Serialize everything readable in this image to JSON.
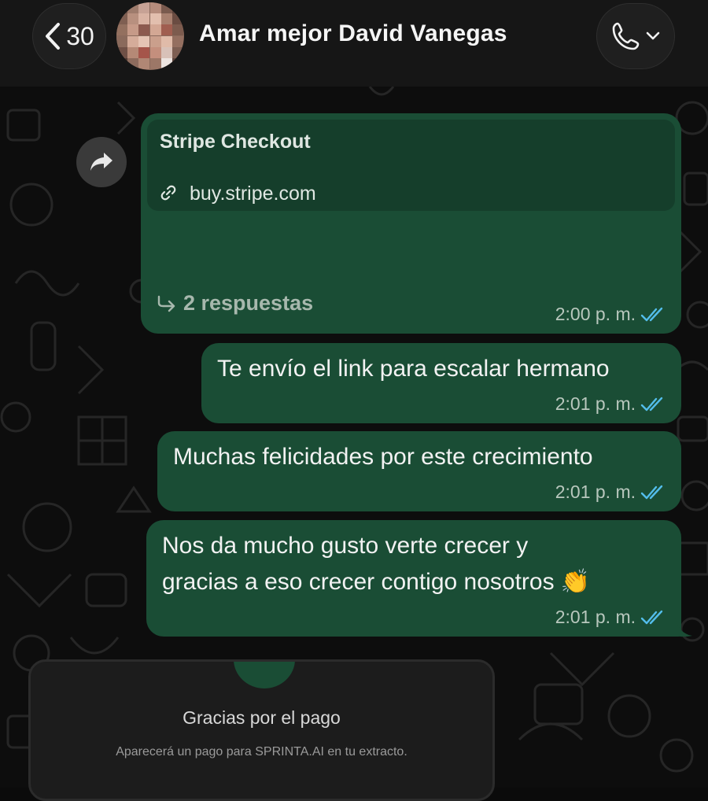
{
  "header": {
    "back_count": "30",
    "contact_name": "Amar mejor David Vanegas"
  },
  "messages": [
    {
      "type": "link-preview",
      "preview_title": "Stripe Checkout",
      "preview_link": "buy.stripe.com",
      "replies": "2 respuestas",
      "time": "2:00 p. m."
    },
    {
      "type": "text",
      "lines": [
        "Te envío el link para escalar hermano"
      ],
      "time": "2:01 p. m."
    },
    {
      "type": "text",
      "lines": [
        "Muchas felicidades por este crecimiento"
      ],
      "time": "2:01 p. m."
    },
    {
      "type": "text",
      "lines": [
        "Nos da mucho gusto verte crecer y",
        "gracias a eso crecer contigo nosotros 👏"
      ],
      "time": "2:01 p. m."
    }
  ],
  "receipt": {
    "title": "Gracias por el pago",
    "subtitle": "Aparecerá un pago para SPRINTA.AI en tu extracto."
  },
  "colors": {
    "bubble": "#1a4d35",
    "read_ticks": "#53bdeb",
    "header": "#161616"
  },
  "icons": {
    "back": "chevron-left-icon",
    "call": "phone-icon",
    "forward": "forward-arrow-icon",
    "link": "link-icon",
    "replies": "reply-arrow-icon",
    "status": "double-check-icon"
  }
}
